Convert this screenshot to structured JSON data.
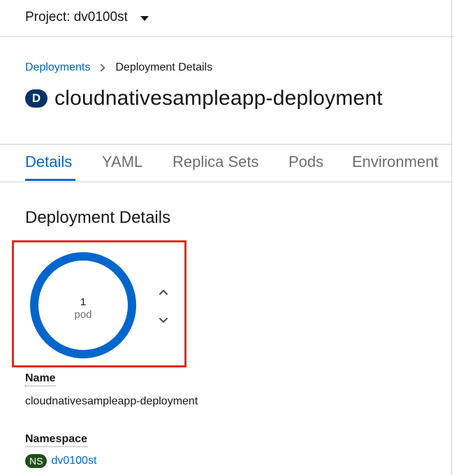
{
  "project_bar": {
    "label": "Project: dv0100st"
  },
  "breadcrumb": {
    "parent": "Deployments",
    "current": "Deployment Details"
  },
  "header": {
    "badge": "D",
    "title": "cloudnativesampleapp-deployment"
  },
  "tabs": [
    {
      "label": "Details",
      "active": true
    },
    {
      "label": "YAML",
      "active": false
    },
    {
      "label": "Replica Sets",
      "active": false
    },
    {
      "label": "Pods",
      "active": false
    },
    {
      "label": "Environment",
      "active": false
    }
  ],
  "section": {
    "heading": "Deployment Details"
  },
  "pods": {
    "count": "1",
    "unit": "pod",
    "ring_color": "#0066cc",
    "icons": [
      "angle-up-icon",
      "angle-down-icon"
    ]
  },
  "fields": {
    "name_label": "Name",
    "name_value": "cloudnativesampleapp-deployment",
    "namespace_label": "Namespace",
    "namespace_badge": "NS",
    "namespace_value": "dv0100st"
  },
  "colors": {
    "link": "#0066cc",
    "highlight": "#e32b1d",
    "deployment_badge": "#003366",
    "namespace_badge": "#1e4f18"
  }
}
